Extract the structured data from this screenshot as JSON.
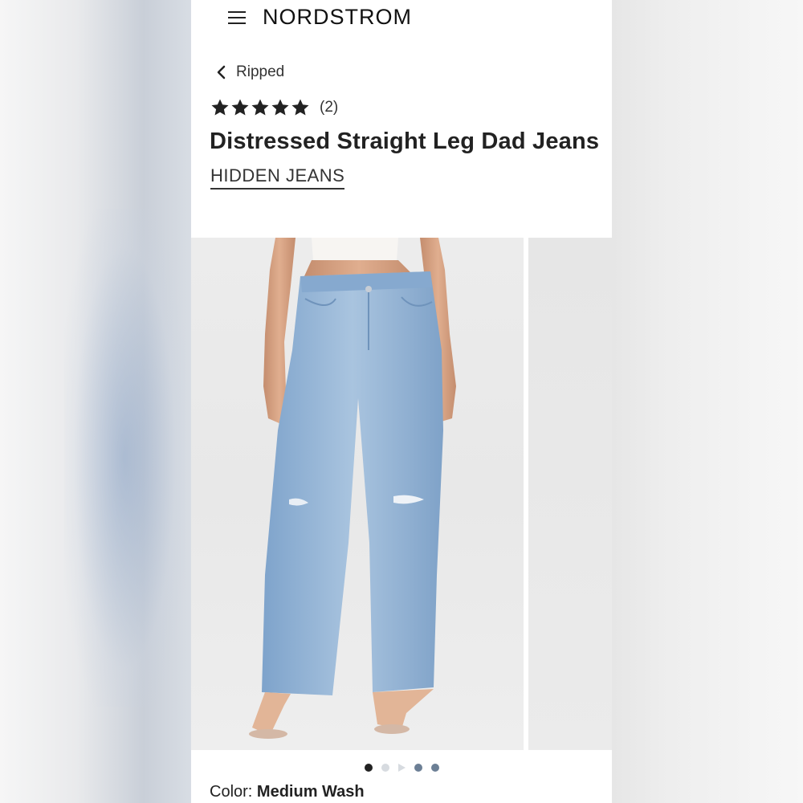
{
  "header": {
    "brand": "NORDSTROM",
    "menu_icon": "hamburger-menu-icon"
  },
  "breadcrumb": {
    "label": "Ripped",
    "icon": "chevron-left-icon"
  },
  "product": {
    "rating_stars": 5,
    "review_count": "(2)",
    "title": "Distressed Straight Leg Dad Jeans",
    "brand": "HIDDEN JEANS"
  },
  "gallery": {
    "image_count": 5,
    "active_index": 0,
    "thumb_icons": [
      "dot",
      "dot",
      "play-icon",
      "dot",
      "dot"
    ]
  },
  "color": {
    "label": "Color:",
    "value": "Medium Wash"
  },
  "colors": {
    "text": "#222222",
    "denim": "#8fb2d6",
    "dot_active": "#222222",
    "dot_inactive": "#d7dbe0",
    "dot_blue": "#6c7f95"
  }
}
